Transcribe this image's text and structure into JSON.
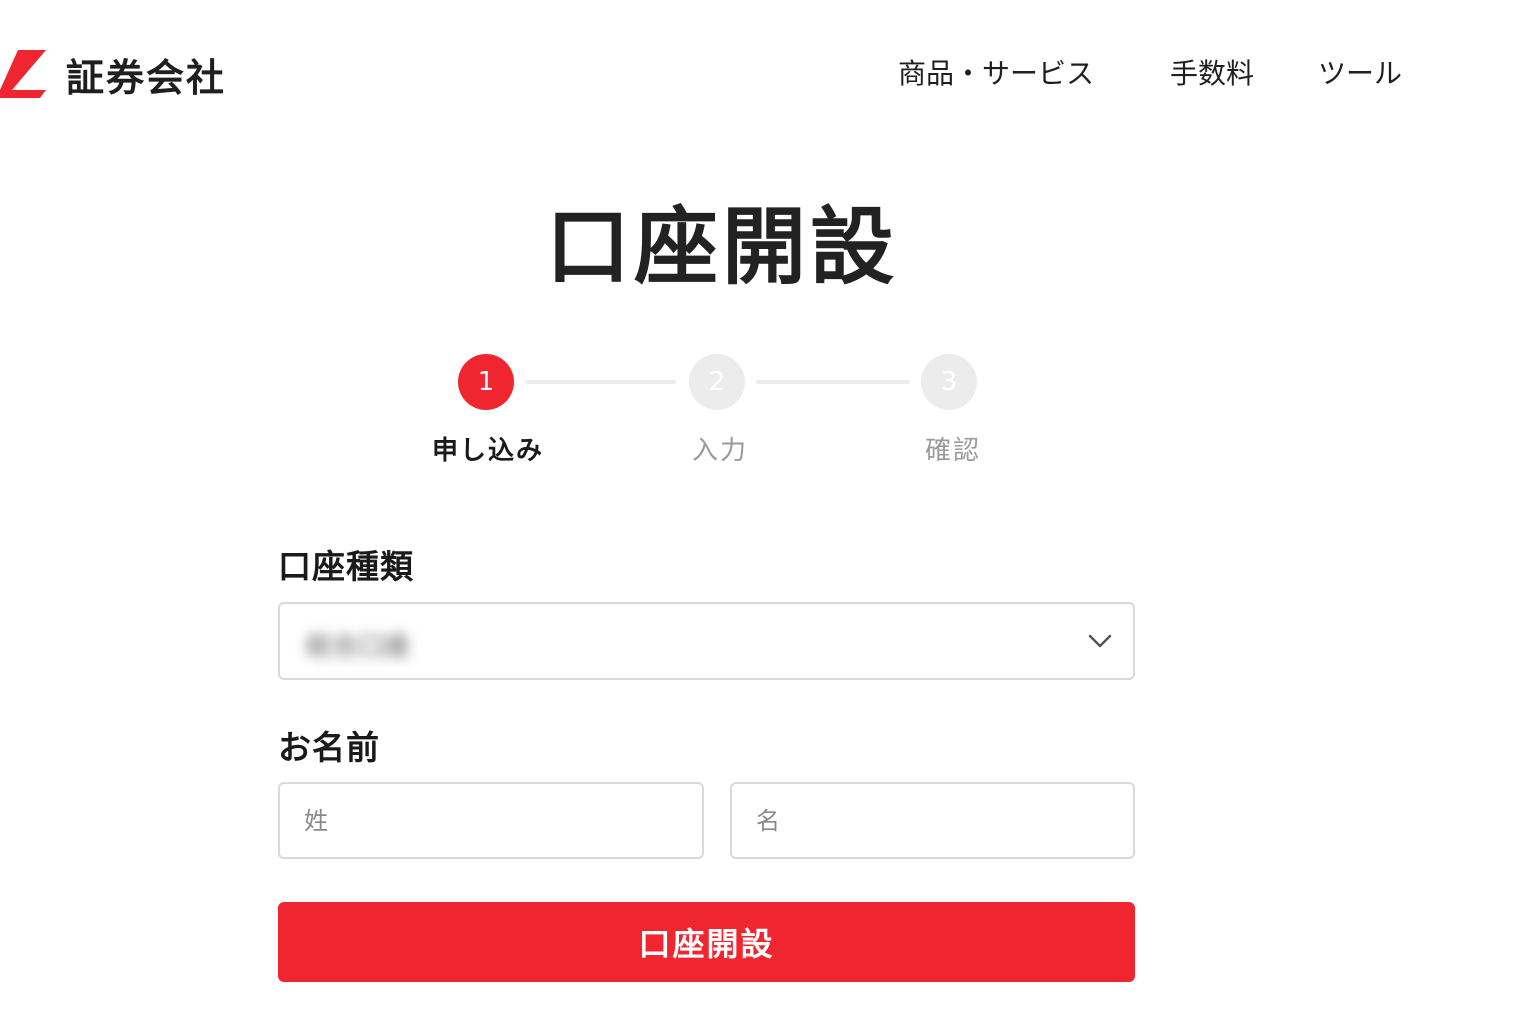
{
  "header": {
    "brand": "証券会社",
    "nav": [
      "商品・サービス",
      "手数料",
      "ツール"
    ]
  },
  "main": {
    "title": "口座開設",
    "steps": [
      {
        "number": "1",
        "label": "申し込み",
        "state": "active"
      },
      {
        "number": "2",
        "label": "入力",
        "state": "inactive"
      },
      {
        "number": "3",
        "label": "確認",
        "state": "inactive"
      }
    ]
  },
  "form": {
    "account_type_label": "口座種類",
    "account_type_value": "総合口座",
    "name_label": "お名前",
    "last_name_placeholder": "姓",
    "first_name_placeholder": "名",
    "submit_label": "口座開設"
  },
  "colors": {
    "brand": "#ef2630",
    "inactive": "#ececec",
    "border": "#d9d9d9"
  },
  "icons": {
    "logo": "brand-logo-mark",
    "select": "chevron-down-icon"
  }
}
